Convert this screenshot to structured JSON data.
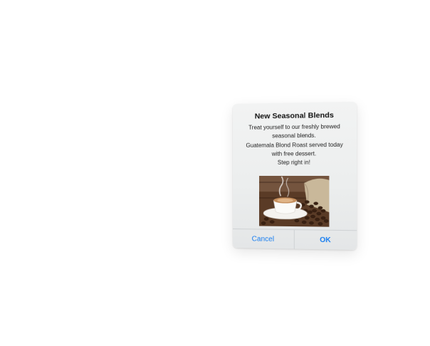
{
  "alert": {
    "title": "New Seasonal Blends",
    "message_lines": [
      "Treat yourself to our freshly brewed",
      "seasonal blends.",
      "Guatemala Blond Roast served today",
      "with free dessert.",
      "Step right in!"
    ],
    "image_icon": "coffee-cup-beans-photo",
    "buttons": {
      "cancel_label": "Cancel",
      "ok_label": "OK"
    },
    "colors": {
      "button_text": "#1a7ff0",
      "background": "#eceeee"
    }
  }
}
